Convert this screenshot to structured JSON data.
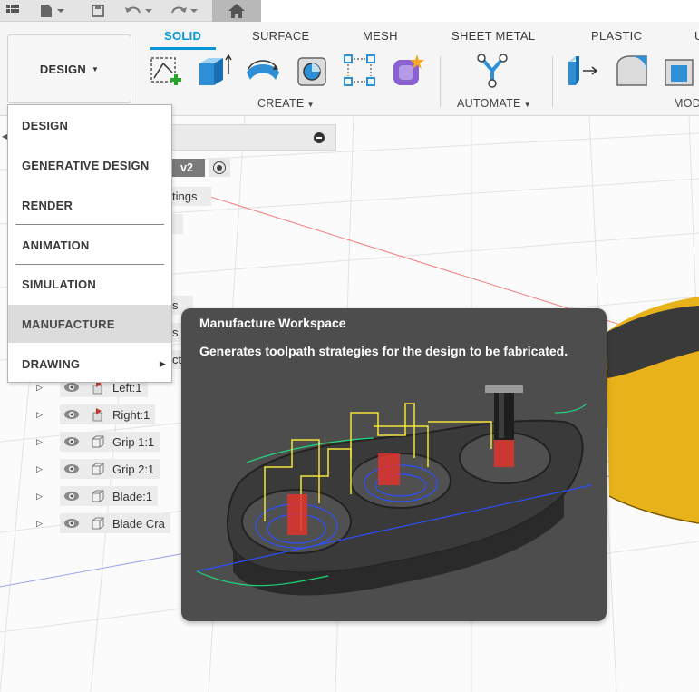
{
  "workspace_button": {
    "label": "DESIGN"
  },
  "tabs": [
    {
      "label": "SOLID",
      "active": true
    },
    {
      "label": "SURFACE",
      "active": false
    },
    {
      "label": "MESH",
      "active": false
    },
    {
      "label": "SHEET METAL",
      "active": false
    },
    {
      "label": "PLASTIC",
      "active": false
    },
    {
      "label": "U",
      "active": false
    }
  ],
  "toolbar_groups": {
    "create": "CREATE",
    "automate": "AUTOMATE",
    "modify": "MOD"
  },
  "browser": {
    "version_badge": "v2",
    "partial_labels": [
      "tings",
      "s",
      "s",
      "cti"
    ],
    "rows": [
      {
        "label": "Left:1",
        "icon": "joint-origin-icon"
      },
      {
        "label": "Right:1",
        "icon": "joint-origin-icon"
      },
      {
        "label": "Grip 1:1",
        "icon": "component-icon"
      },
      {
        "label": "Grip 2:1",
        "icon": "component-icon"
      },
      {
        "label": "Blade:1",
        "icon": "component-icon"
      },
      {
        "label": "Blade Cra",
        "icon": "component-icon"
      }
    ]
  },
  "workspace_menu": {
    "items": [
      {
        "label": "DESIGN"
      },
      {
        "label": "GENERATIVE DESIGN"
      },
      {
        "label": "RENDER"
      },
      {
        "label": "ANIMATION"
      },
      {
        "label": "SIMULATION"
      },
      {
        "label": "MANUFACTURE",
        "hovered": true
      },
      {
        "label": "DRAWING",
        "submenu": true
      }
    ]
  },
  "tooltip": {
    "title": "Manufacture Workspace",
    "description": "Generates toolpath strategies for the design to be fabricated."
  },
  "colors": {
    "accent": "#0696d7",
    "tooltip_bg": "#4d4d4d",
    "menu_hover": "#dcdcdc"
  }
}
